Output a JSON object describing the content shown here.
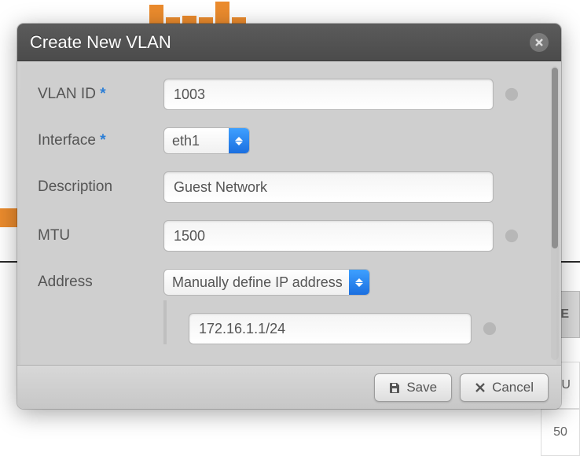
{
  "dialog": {
    "title": "Create New VLAN"
  },
  "labels": {
    "vlan_id": "VLAN ID",
    "interface": "Interface",
    "description": "Description",
    "mtu": "MTU",
    "address": "Address"
  },
  "values": {
    "vlan_id": "1003",
    "interface": "eth1",
    "description": "Guest Network",
    "mtu": "1500",
    "address_mode": "Manually define IP address",
    "ip": "172.16.1.1/24"
  },
  "buttons": {
    "save": "Save",
    "cancel": "Cancel"
  },
  "bg": {
    "col1": "DE",
    "cell1": "ITU",
    "cell2": "50"
  }
}
